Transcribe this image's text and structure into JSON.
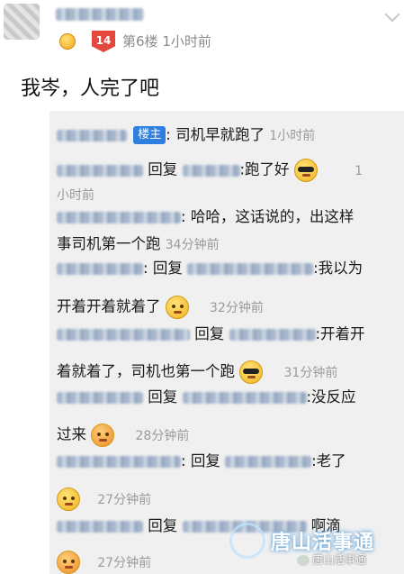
{
  "post": {
    "level": "14",
    "floor": "第6楼",
    "time": "1小时前",
    "content": "我岑，人完了吧"
  },
  "replies": [
    {
      "id": 0,
      "badge": "楼主",
      "colon": ":",
      "text": "司机早就跑了",
      "time": "1小时前"
    },
    {
      "id": 1,
      "reply": "回复",
      "text": ":跑了好",
      "time": "1"
    },
    {
      "id": 2,
      "time_cont": "小时前"
    },
    {
      "id": 3,
      "colon": ":",
      "text": "哈哈，这话说的，出这样"
    },
    {
      "id": 4,
      "text": "事司机第一个跑",
      "time": "34分钟前"
    },
    {
      "id": 5,
      "colon": ":",
      "reply": "回复",
      "text": ":我以为"
    },
    {
      "id": 6,
      "text": "开着开着就着了",
      "time": "32分钟前",
      "reply": "回复",
      "text2": ":开着开"
    },
    {
      "id": 7,
      "text": "着就着了，司机也第一个跑",
      "time": "31分钟前"
    },
    {
      "id": 8,
      "reply": "回复",
      "text": ":没反应"
    },
    {
      "id": 9,
      "text": "过来",
      "time": "28分钟前"
    },
    {
      "id": 10,
      "colon": ":",
      "reply": "回复",
      "text": ":老了"
    },
    {
      "id": 11,
      "time": "27分钟前"
    },
    {
      "id": 12,
      "reply": "回复",
      "text": "啊滴"
    },
    {
      "id": 13,
      "time": "27分钟前"
    }
  ],
  "watermark": {
    "brand": "唐山活事通",
    "small": "唐山活事通"
  },
  "icons": {
    "menu": "chevron-down-icon",
    "medal": "medal-icon"
  }
}
